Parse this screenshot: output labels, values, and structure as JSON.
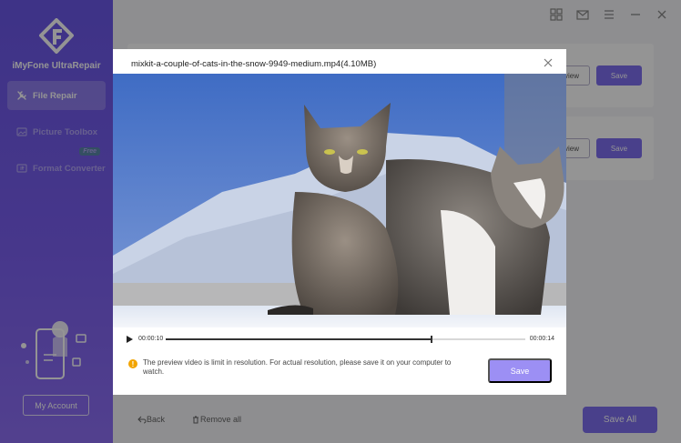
{
  "sidebar": {
    "brand": "iMyFone UltraRepair",
    "items": [
      {
        "label": "File Repair",
        "icon": "wrench-icon"
      },
      {
        "label": "Picture Toolbox",
        "icon": "image-icon"
      },
      {
        "label": "Format Converter",
        "icon": "convert-icon",
        "badge": "Free"
      }
    ],
    "account_label": "My Account"
  },
  "topbar": {
    "icons": [
      "grid-icon",
      "mail-icon",
      "menu-icon",
      "minimize-icon",
      "close-icon"
    ]
  },
  "cards": [
    {
      "preview_label": "view",
      "save_label": "Save"
    },
    {
      "preview_label": "view",
      "save_label": "Save"
    }
  ],
  "bottom": {
    "back_label": "Back",
    "remove_label": "Remove all",
    "save_all_label": "Save All"
  },
  "modal": {
    "title": "mixkit-a-couple-of-cats-in-the-snow-9949-medium.mp4(4.10MB)",
    "current_time": "00:00:10",
    "total_time": "00:00:14",
    "progress": 0.74,
    "notice": "The preview video is limit in resolution. For actual resolution, please save it on your computer to watch.",
    "save_label": "Save"
  },
  "colors": {
    "accent": "#7e6ef0",
    "sidebar_top": "#6b58e8",
    "warning": "#f2a400",
    "free_badge": "#3fbf5a"
  }
}
